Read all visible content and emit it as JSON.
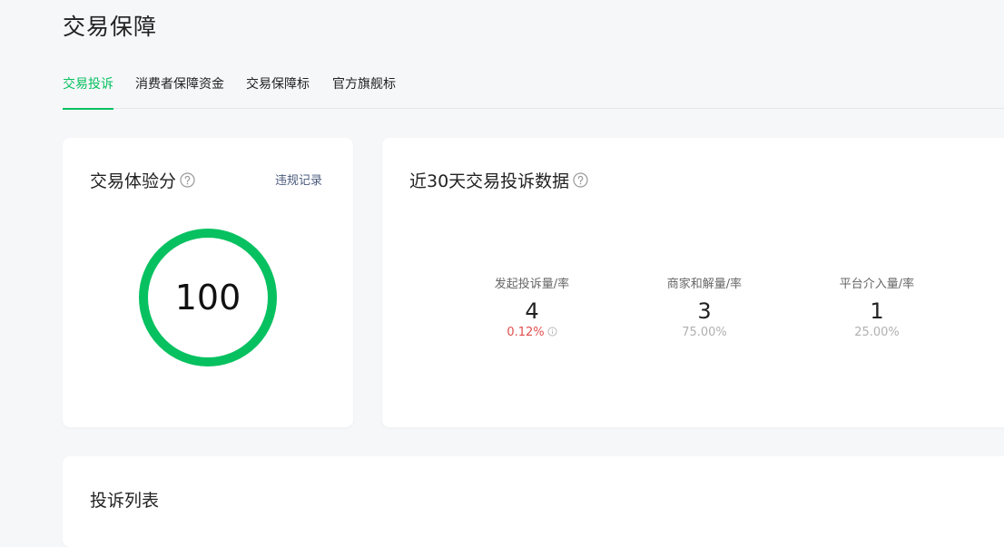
{
  "page": {
    "title": "交易保障"
  },
  "tabs": [
    {
      "label": "交易投诉",
      "active": true
    },
    {
      "label": "消费者保障资金",
      "active": false
    },
    {
      "label": "交易保障标",
      "active": false
    },
    {
      "label": "官方旗舰标",
      "active": false
    }
  ],
  "experience_card": {
    "title": "交易体验分",
    "link_label": "违规记录",
    "score": "100",
    "score_fraction": 1.0,
    "ring_color": "#07c160"
  },
  "complaint_card": {
    "title": "近30天交易投诉数据",
    "stats": [
      {
        "label": "发起投诉量/率",
        "value": "4",
        "rate": "0.12%",
        "rate_color": "#e34d4d"
      },
      {
        "label": "商家和解量/率",
        "value": "3",
        "rate": "75.00%"
      },
      {
        "label": "平台介入量/率",
        "value": "1",
        "rate": "25.00%"
      }
    ]
  },
  "list_card": {
    "title": "投诉列表"
  },
  "colors": {
    "accent": "#07c160",
    "alert": "#e34d4d"
  },
  "icons": [
    "help-icon",
    "info-icon"
  ]
}
